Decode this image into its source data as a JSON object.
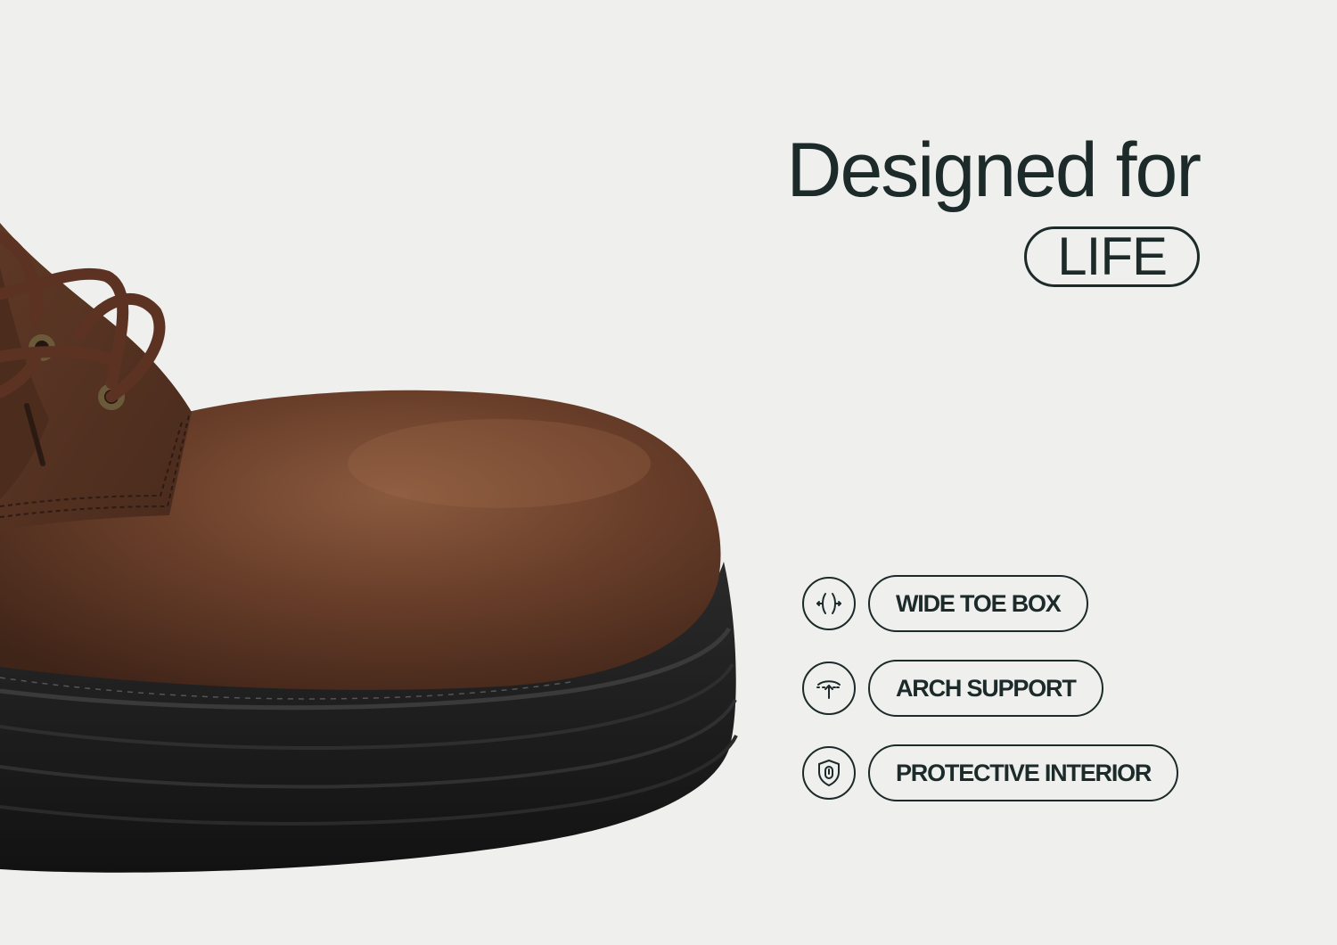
{
  "headline": {
    "line1": "Designed for",
    "highlight": "LIFE"
  },
  "features": [
    {
      "label": "WIDE TOE BOX",
      "icon": "wide-toe-box-icon"
    },
    {
      "label": "ARCH SUPPORT",
      "icon": "arch-support-icon"
    },
    {
      "label": "PROTECTIVE INTERIOR",
      "icon": "protective-interior-icon"
    }
  ],
  "colors": {
    "background": "#efefee",
    "ink": "#1c2a2a",
    "leather": "#5a3322",
    "sole": "#1a1a1a"
  }
}
